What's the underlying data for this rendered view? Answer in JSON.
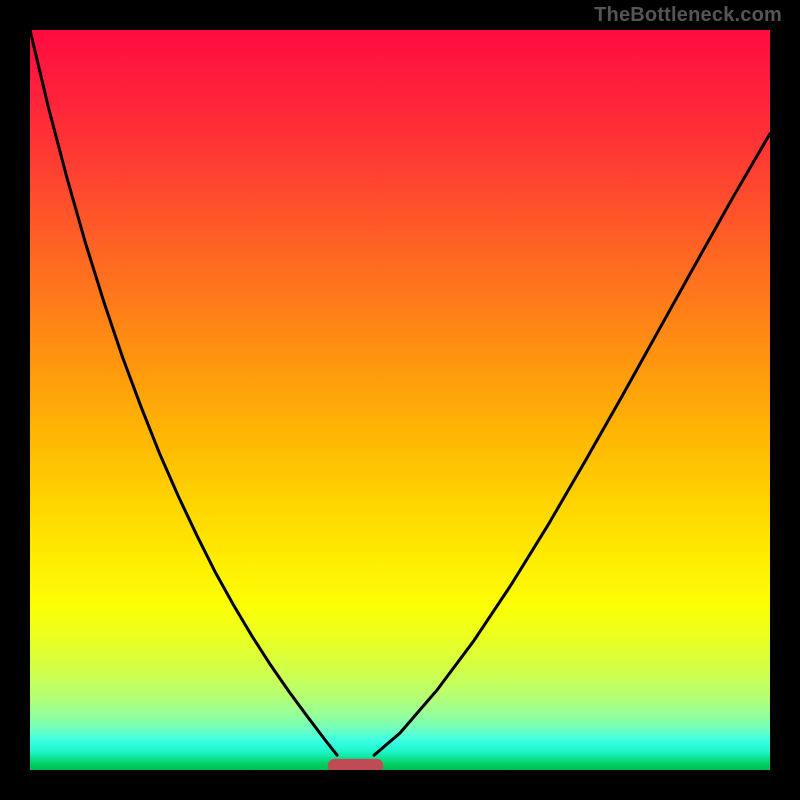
{
  "watermark": {
    "text": "TheBottleneck.com"
  },
  "chart_data": {
    "type": "line",
    "title": "",
    "xlabel": "",
    "ylabel": "",
    "xlim": [
      0,
      1
    ],
    "ylim": [
      0,
      1
    ],
    "grid": false,
    "legend": false,
    "series": [
      {
        "name": "left-branch",
        "x": [
          0.0,
          0.025,
          0.05,
          0.075,
          0.1,
          0.125,
          0.15,
          0.175,
          0.2,
          0.225,
          0.25,
          0.275,
          0.3,
          0.325,
          0.35,
          0.375,
          0.4,
          0.415
        ],
        "y": [
          1.0,
          0.895,
          0.8,
          0.712,
          0.632,
          0.558,
          0.491,
          0.428,
          0.371,
          0.318,
          0.268,
          0.223,
          0.181,
          0.142,
          0.106,
          0.072,
          0.039,
          0.02
        ]
      },
      {
        "name": "right-branch",
        "x": [
          0.465,
          0.5,
          0.55,
          0.6,
          0.65,
          0.7,
          0.75,
          0.8,
          0.85,
          0.9,
          0.95,
          1.0
        ],
        "y": [
          0.02,
          0.05,
          0.108,
          0.175,
          0.25,
          0.331,
          0.417,
          0.505,
          0.595,
          0.685,
          0.774,
          0.86
        ]
      }
    ],
    "marker": {
      "name": "baseline-marker",
      "shape": "rounded-rect",
      "x_center": 0.44,
      "y_center": 0.006,
      "width": 0.075,
      "height": 0.018,
      "color": "#bf4b55"
    },
    "background": {
      "type": "vertical-gradient",
      "stops": [
        {
          "pos": 0.0,
          "color": "#ff0b40"
        },
        {
          "pos": 0.38,
          "color": "#ff7f18"
        },
        {
          "pos": 0.7,
          "color": "#ffe800"
        },
        {
          "pos": 0.9,
          "color": "#b5ff73"
        },
        {
          "pos": 1.0,
          "color": "#00be4c"
        }
      ]
    }
  }
}
